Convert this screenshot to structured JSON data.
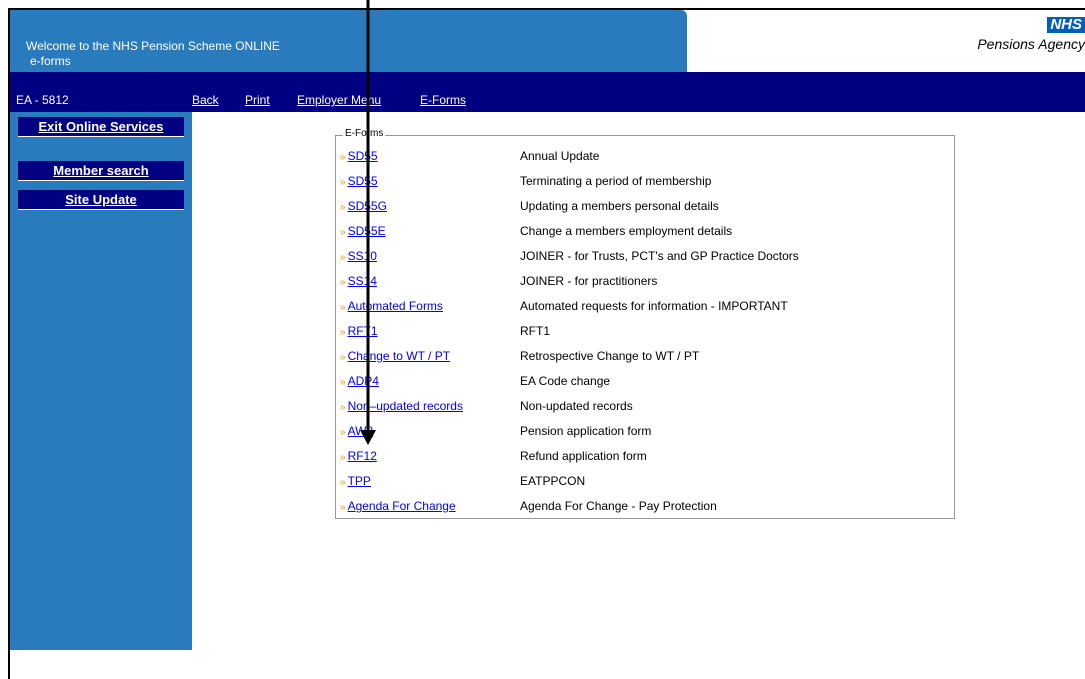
{
  "header": {
    "title_line1": "Welcome to the NHS Pension Scheme ONLINE",
    "title_line2": "e-forms",
    "logo_text": "NHS",
    "agency_name": "Pensions Agency"
  },
  "nav": {
    "ea_code": "EA - 5812",
    "links": [
      "Back",
      "Print",
      "Employer Menu",
      "E-Forms"
    ]
  },
  "sidebar": {
    "buttons": [
      "Exit Online Services",
      "Member search",
      "Site Update"
    ]
  },
  "eforms": {
    "legend": "E-Forms",
    "bullet": "»",
    "rows": [
      {
        "link": "SD55",
        "desc": "Annual Update"
      },
      {
        "link": "SD55",
        "desc": "Terminating a period of membership"
      },
      {
        "link": "SD55G",
        "desc": "Updating a members personal details"
      },
      {
        "link": "SD55E",
        "desc": "Change a members employment details"
      },
      {
        "link": "SS10",
        "desc": "JOINER - for Trusts, PCT's and GP Practice Doctors"
      },
      {
        "link": "SS14",
        "desc": "JOINER - for practitioners"
      },
      {
        "link": "Automated Forms",
        "desc": "Automated requests for information - IMPORTANT"
      },
      {
        "link": "RFT1",
        "desc": "RFT1"
      },
      {
        "link": "Change to WT / PT",
        "desc": "Retrospective Change to WT / PT"
      },
      {
        "link": "ADP4",
        "desc": "EA Code change"
      },
      {
        "link": "Non–updated records",
        "desc": "Non-updated records"
      },
      {
        "link": "AW8",
        "desc": "Pension application form"
      },
      {
        "link": "RF12",
        "desc": "Refund application form"
      },
      {
        "link": "TPP",
        "desc": "EATPPCON"
      },
      {
        "link": "Agenda For Change",
        "desc": "Agenda For Change - Pay Protection"
      }
    ]
  },
  "colors": {
    "header_blue": "#2a7abe",
    "nav_navy": "#000080",
    "link_blue": "#0000ee",
    "bullet_gold": "#e0a000"
  }
}
